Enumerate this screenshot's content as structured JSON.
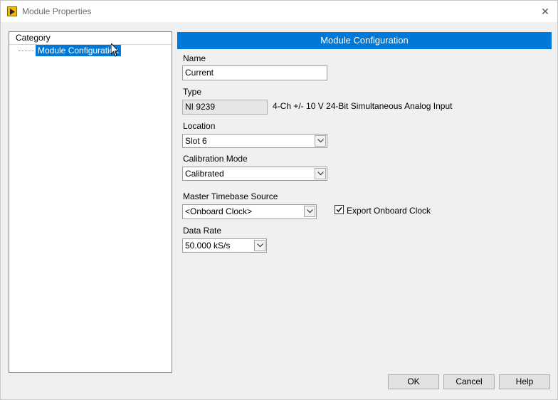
{
  "window": {
    "title": "Module Properties",
    "icon": "labview-arrow-icon",
    "close_glyph": "✕"
  },
  "category": {
    "header": "Category",
    "items": [
      {
        "label": "Module Configuration",
        "selected": true
      }
    ]
  },
  "config": {
    "header": "Module Configuration",
    "name_label": "Name",
    "name_value": "Current",
    "type_label": "Type",
    "type_value": "NI 9239",
    "type_description": "4-Ch +/- 10 V 24-Bit Simultaneous Analog Input",
    "location_label": "Location",
    "location_value": "Slot 6",
    "calibration_label": "Calibration Mode",
    "calibration_value": "Calibrated",
    "timebase_label": "Master Timebase Source",
    "timebase_value": "<Onboard Clock>",
    "export_clock_label": "Export Onboard Clock",
    "export_clock_checked": true,
    "data_rate_label": "Data Rate",
    "data_rate_value": "50.000 kS/s"
  },
  "buttons": {
    "ok": "OK",
    "cancel": "Cancel",
    "help": "Help"
  },
  "colors": {
    "accent": "#0078d7",
    "background": "#f0f0f0"
  }
}
